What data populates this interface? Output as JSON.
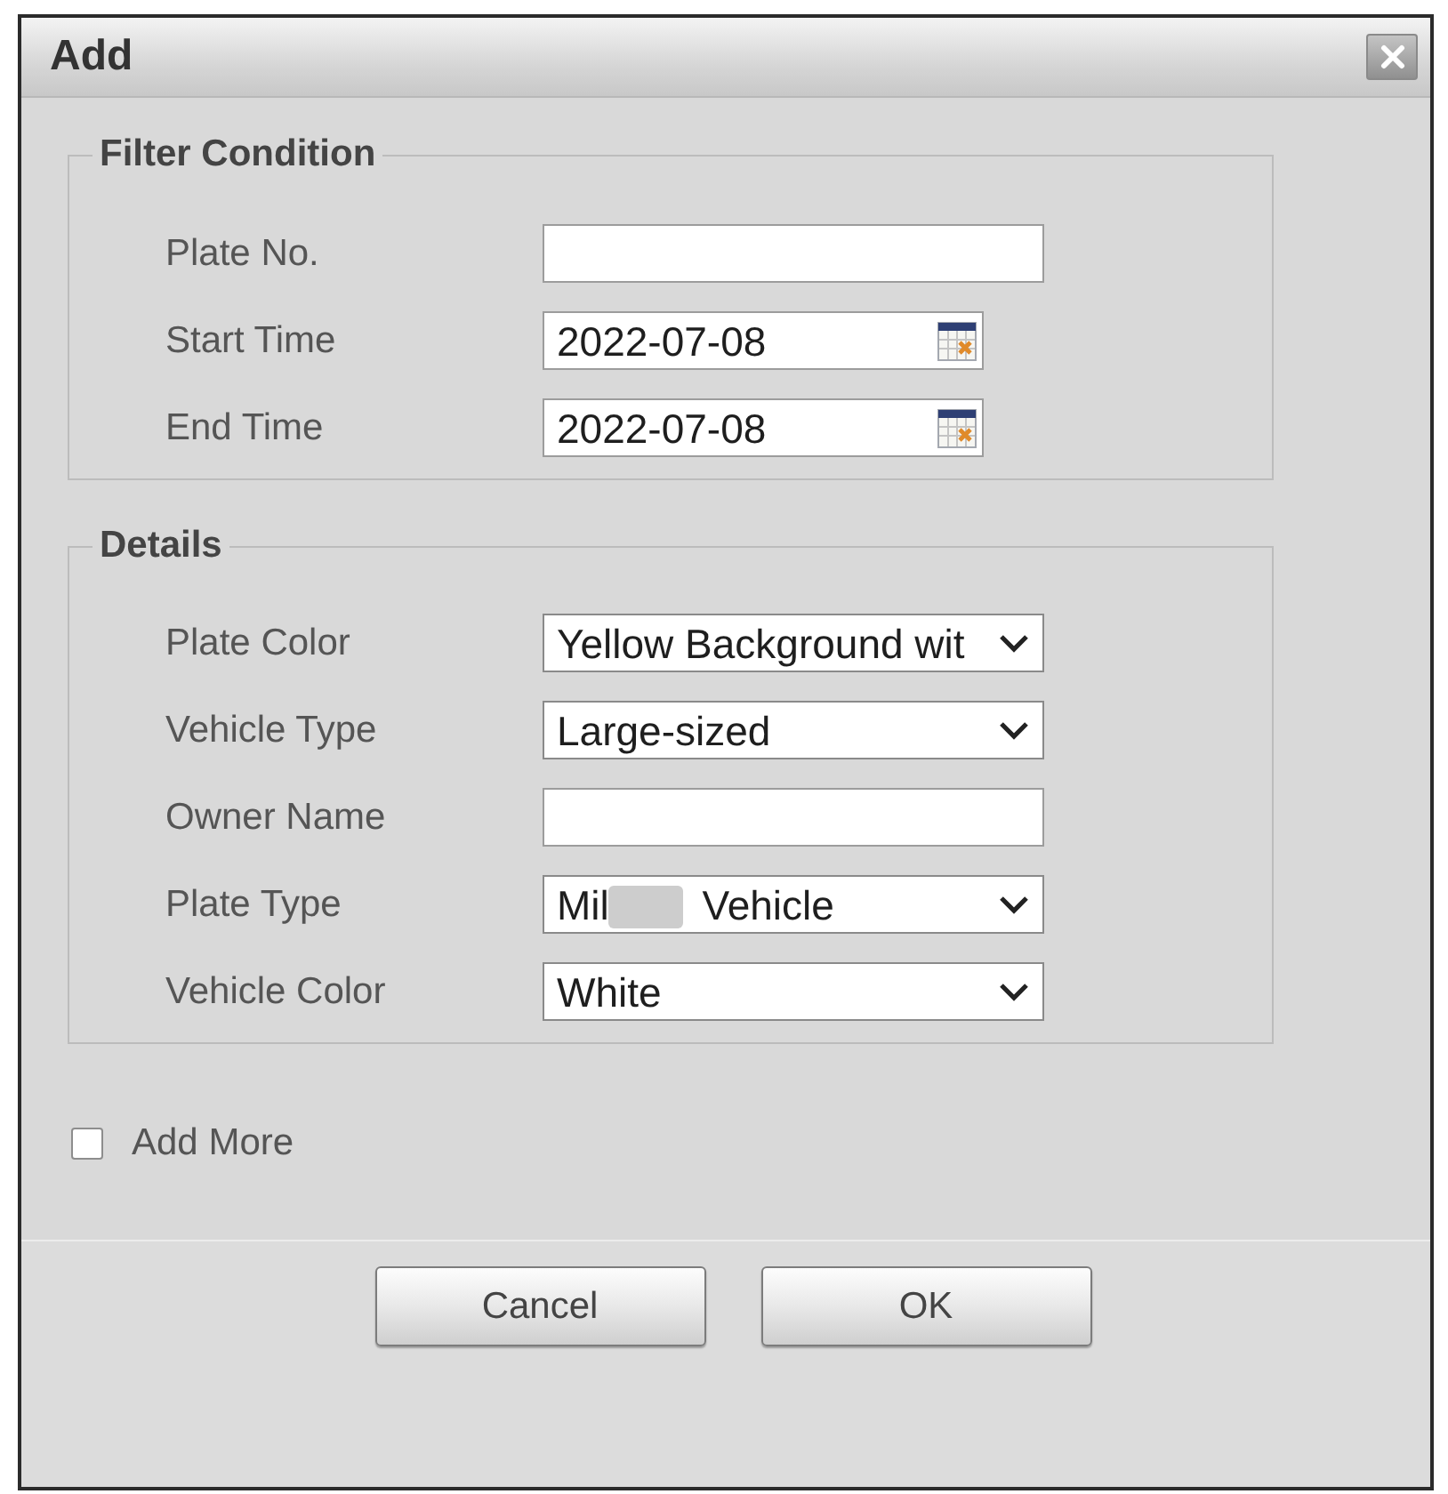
{
  "dialog": {
    "title": "Add"
  },
  "sections": [
    {
      "legend": "Filter Condition",
      "fields": [
        {
          "label": "Plate No.",
          "kind": "text"
        },
        {
          "label": "Start Time",
          "kind": "date",
          "value": "2022-07-08"
        },
        {
          "label": "End Time",
          "kind": "date",
          "value": "2022-07-08"
        }
      ]
    },
    {
      "legend": "Details",
      "fields": [
        {
          "label": "Plate Color",
          "kind": "select",
          "value": "Yellow Background wit"
        },
        {
          "label": "Vehicle Type",
          "kind": "select",
          "value": "Large-sized"
        },
        {
          "label": "Owner Name",
          "kind": "text"
        },
        {
          "label": "Plate Type",
          "kind": "select",
          "value": "Mil",
          "redacted": true,
          "value_tail": "Vehicle"
        },
        {
          "label": "Vehicle Color",
          "kind": "select",
          "value": "White"
        }
      ]
    }
  ],
  "add_more": {
    "label": "Add More",
    "checked": false
  },
  "buttons": [
    "Cancel",
    "OK"
  ]
}
